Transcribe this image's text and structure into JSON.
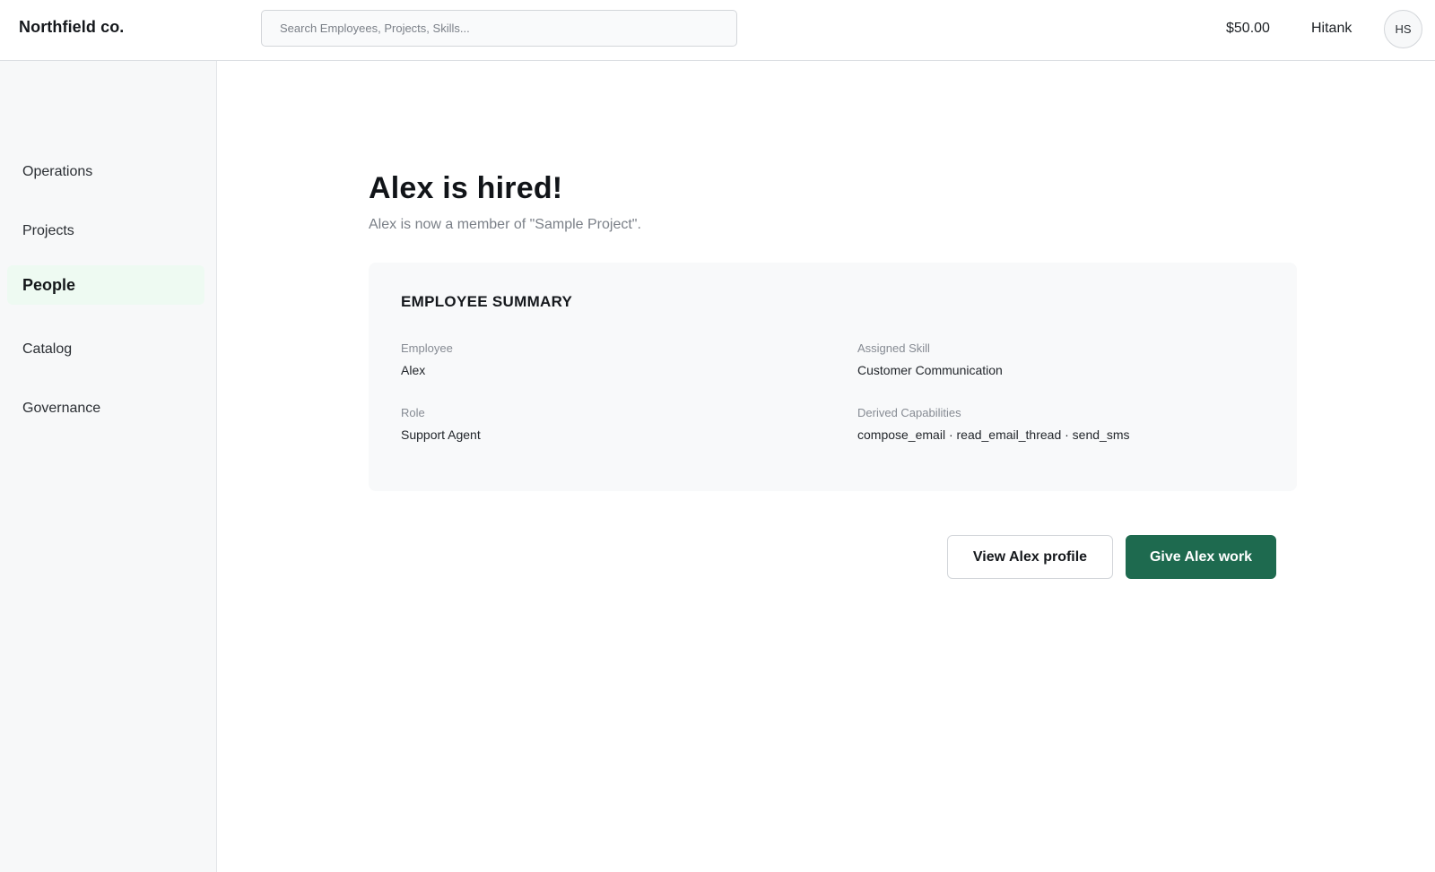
{
  "header": {
    "brand": "Northfield co.",
    "search_placeholder": "Search Employees, Projects, Skills...",
    "balance": "$50.00",
    "username": "Hitank",
    "avatar_initials": "HS"
  },
  "sidebar": {
    "items": [
      {
        "label": "Operations",
        "active": false
      },
      {
        "label": "Projects",
        "active": false
      },
      {
        "label": "People",
        "active": true
      },
      {
        "label": "Catalog",
        "active": false
      },
      {
        "label": "Governance",
        "active": false
      }
    ]
  },
  "main": {
    "title": "Alex is hired!",
    "subtitle": "Alex is now a member of \"Sample Project\".",
    "summary": {
      "title": "EMPLOYEE SUMMARY",
      "employee_label": "Employee",
      "employee_value": "Alex",
      "role_label": "Role",
      "role_value": "Support Agent",
      "skill_label": "Assigned Skill",
      "skill_value": "Customer Communication",
      "capabilities_label": "Derived Capabilities",
      "capabilities_value": "compose_email · read_email_thread · send_sms"
    },
    "actions": {
      "view_profile": "View Alex profile",
      "give_work": "Give Alex work"
    }
  },
  "colors": {
    "accent": "#1e6a4f",
    "active_nav_bg": "#eefaf2"
  }
}
